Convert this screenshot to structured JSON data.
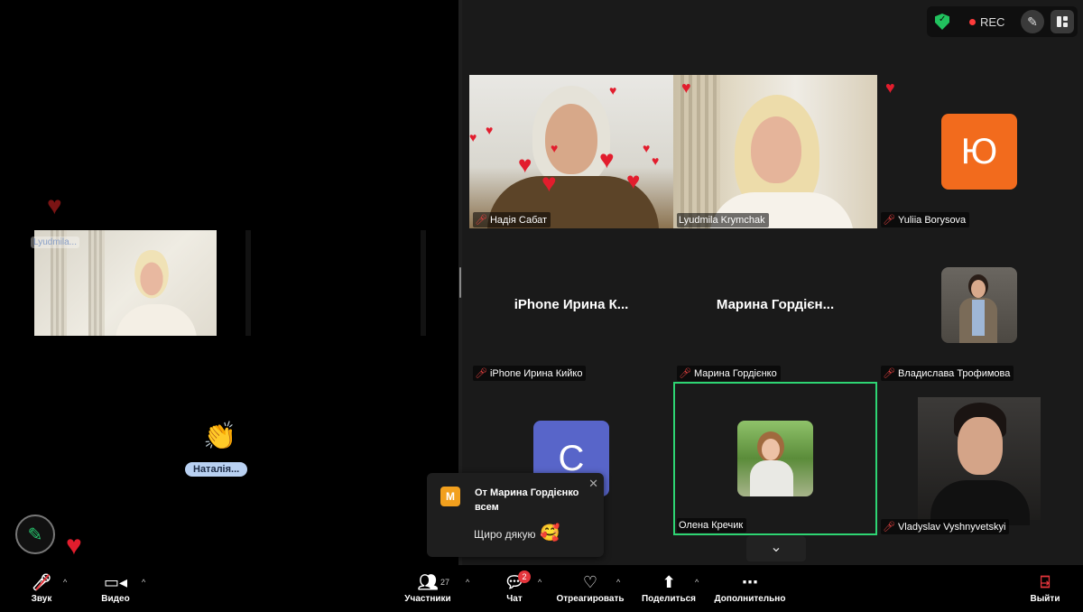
{
  "shared_screen": {
    "lyudmila_label": "Lyudmila...",
    "raised_hand_name": "Наталія..."
  },
  "top_controls": {
    "rec_label": "REC"
  },
  "gallery": {
    "tiles": [
      {
        "name": "Надія Сабат",
        "muted": true
      },
      {
        "name": "Lyudmila Krymchak",
        "muted": false
      },
      {
        "name": "Yuliia Borysova",
        "muted": true,
        "avatar_letter": "Ю",
        "avatar_color": "#f26b1d"
      },
      {
        "name": "iPhone Ирина Кийко",
        "muted": true,
        "display_name": "iPhone Ирина К..."
      },
      {
        "name": "Марина Гордієнко",
        "muted": true,
        "display_name": "Марина Гордієн..."
      },
      {
        "name": "Владислава Трофимова",
        "muted": true
      },
      {
        "name": "",
        "muted": false,
        "avatar_letter": "С",
        "avatar_color": "#5865c9"
      },
      {
        "name": "Олена Кречик",
        "muted": false,
        "active_speaker": true
      },
      {
        "name": "Vladyslav Vyshnyvetskyi",
        "muted": true
      }
    ]
  },
  "notification": {
    "avatar_letter": "M",
    "from": "От Марина Гордієнко всем",
    "message": "Щиро дякую",
    "emoji": "🥰"
  },
  "toolbar": {
    "audio_label": "Звук",
    "video_label": "Видео",
    "participants_label": "Участники",
    "participants_count": "27",
    "chat_label": "Чат",
    "chat_badge": "2",
    "react_label": "Отреагировать",
    "share_label": "Поделиться",
    "more_label": "Дополнительно",
    "leave_label": "Выйти"
  },
  "colors": {
    "active_speaker_border": "#2ed573",
    "muted_icon": "#e0403f",
    "badge": "#e5353c",
    "heart": "#e21d2d"
  }
}
